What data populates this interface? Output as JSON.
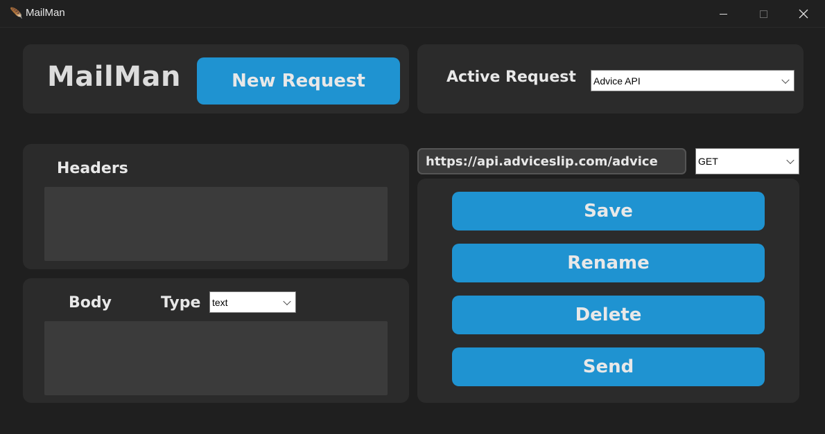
{
  "window": {
    "title": "MailMan",
    "icon": "feather-icon"
  },
  "header": {
    "brand": "MailMan",
    "new_request_label": "New Request"
  },
  "active_request": {
    "label": "Active Request",
    "selected": "Advice API"
  },
  "request": {
    "url": "https://api.adviceslip.com/advice",
    "method": "GET"
  },
  "headers_section": {
    "label": "Headers",
    "value": ""
  },
  "body_section": {
    "label": "Body",
    "type_label": "Type",
    "type_selected": "text",
    "value": ""
  },
  "actions": {
    "save": "Save",
    "rename": "Rename",
    "delete": "Delete",
    "send": "Send"
  },
  "colors": {
    "accent": "#1f93d1",
    "background": "#1f1f1f",
    "panel": "#2b2b2b",
    "textarea": "#3b3b3b"
  }
}
